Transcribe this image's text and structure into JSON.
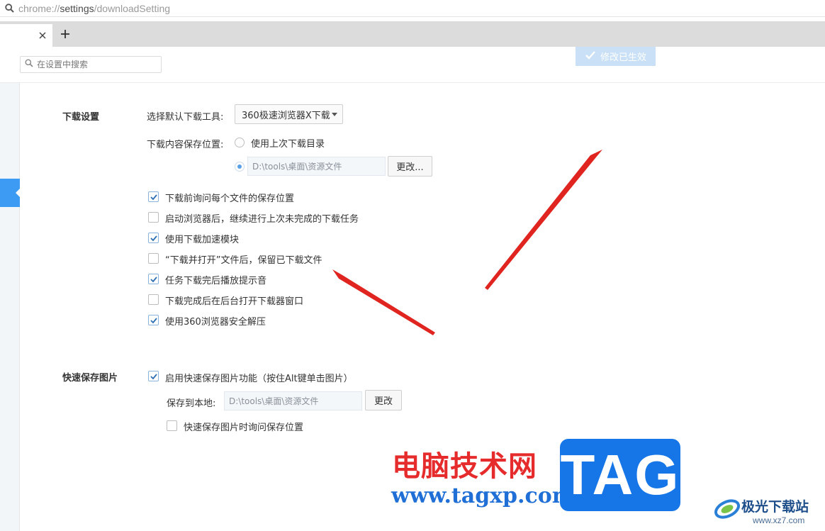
{
  "address_bar": {
    "url_prefix": "chrome://",
    "url_main": "settings",
    "url_suffix": "/downloadSetting"
  },
  "top": {
    "search_placeholder": "在设置中搜索",
    "applied_label": "修改已生效"
  },
  "download_section": {
    "title": "下载设置",
    "default_tool_label": "选择默认下载工具:",
    "default_tool_value": "360极速浏览器X下载",
    "save_location_label": "下载内容保存位置:",
    "radio_last_dir_label": "使用上次下载目录",
    "radio_last_dir_checked": false,
    "radio_custom_checked": true,
    "custom_path": "D:\\tools\\桌面\\资源文件",
    "change_button": "更改...",
    "options": [
      {
        "label": "下载前询问每个文件的保存位置",
        "checked": true
      },
      {
        "label": "启动浏览器后，继续进行上次未完成的下载任务",
        "checked": false
      },
      {
        "label": "使用下载加速模块",
        "checked": true
      },
      {
        "label": "“下载并打开”文件后，保留已下载文件",
        "checked": false
      },
      {
        "label": "任务下载完后播放提示音",
        "checked": true
      },
      {
        "label": "下载完成后在后台打开下载器窗口",
        "checked": false
      },
      {
        "label": "使用360浏览器安全解压",
        "checked": true
      }
    ]
  },
  "quick_save_section": {
    "title": "快速保存图片",
    "enable_label": "启用快速保存图片功能（按住Alt键单击图片）",
    "enable_checked": true,
    "save_local_label": "保存到本地:",
    "save_path": "D:\\tools\\桌面\\资源文件",
    "change_button": "更改",
    "ask_location_label": "快速保存图片时询问保存位置",
    "ask_location_checked": false
  },
  "watermark": {
    "cn_text": "电脑技术网",
    "url_text": "www.tagxp.com",
    "tag_text": "TAG",
    "logo_text": "极光下载站",
    "logo_url": "www.xz7.com"
  },
  "colors": {
    "accent": "#3e9bf4",
    "arrow": "#e0241f",
    "watermark_red": "#e52b2b",
    "watermark_blue": "#1676e8"
  }
}
